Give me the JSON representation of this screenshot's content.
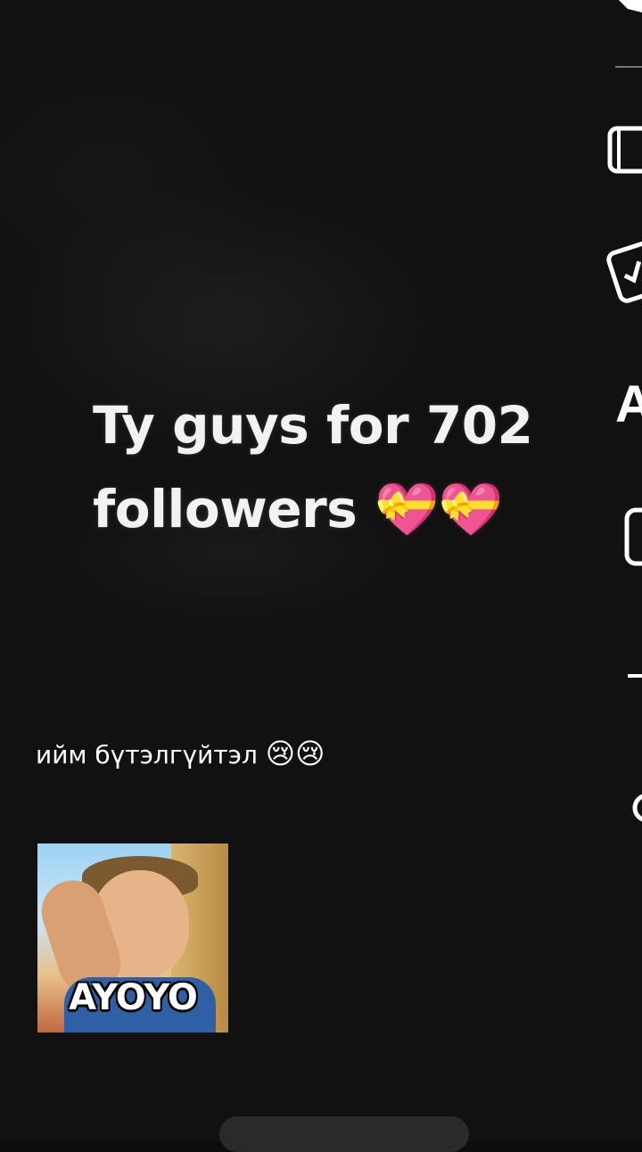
{
  "post": {
    "headline_line1": "Ty guys for 702",
    "headline_line2": "followers",
    "headline_emoji": "💝💝",
    "caption_text": "ийм бүтэлгүйтэл",
    "caption_emoji": "😢😢"
  },
  "sticker": {
    "text": "AYOYO"
  },
  "right_rail": {
    "partial_letter": "A"
  }
}
